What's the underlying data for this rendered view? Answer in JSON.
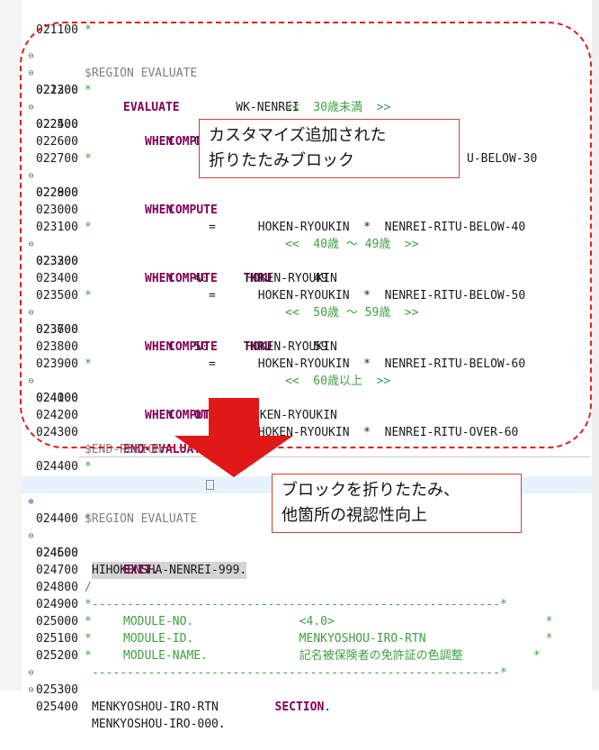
{
  "annotations": {
    "callout1": [
      "カスタマイズ追加された",
      "折りたたみブロック"
    ],
    "callout2": [
      "ブロックを折りたたみ、",
      "他箇所の視認性向上"
    ]
  },
  "top_lines": [
    {
      "seq": "021100",
      "mark": "*",
      "code": ""
    },
    {
      "seq": "",
      "mark": "",
      "code": "$REGION EVALUATE"
    },
    {
      "seq": "021200",
      "mark": "",
      "code": "EVALUATE        WK-NENREI"
    },
    {
      "seq": "022300",
      "mark": "*",
      "code": "<<  30歳未満  >>"
    },
    {
      "seq": "022400",
      "mark": "",
      "code": "WHEN   0      THRU      29"
    },
    {
      "seq": "022500",
      "mark": "",
      "code": "COMPUTE    HOKEN-RYOUKIN"
    },
    {
      "seq": "022600",
      "mark": "",
      "code": "U-BELOW-30"
    },
    {
      "seq": "022700",
      "mark": "*",
      "code": ""
    },
    {
      "seq": "022800",
      "mark": "",
      "code": "WHEN"
    },
    {
      "seq": "022900",
      "mark": "",
      "code": "COMPUTE"
    },
    {
      "seq": "023000",
      "mark": "",
      "code": "=      HOKEN-RYOUKIN  *  NENREI-RITU-BELOW-40"
    },
    {
      "seq": "023100",
      "mark": "*",
      "code": "<<  40歳 ～ 49歳  >>"
    },
    {
      "seq": "023200",
      "mark": "",
      "code": "WHEN   40     THRU      49"
    },
    {
      "seq": "023300",
      "mark": "",
      "code": "COMPUTE    HOKEN-RYOUKIN"
    },
    {
      "seq": "023400",
      "mark": "",
      "code": "=      HOKEN-RYOUKIN  *  NENREI-RITU-BELOW-50"
    },
    {
      "seq": "023500",
      "mark": "*",
      "code": "<<  50歳 ～ 59歳  >>"
    },
    {
      "seq": "023600",
      "mark": "",
      "code": "WHEN   50     THRU      59"
    },
    {
      "seq": "023700",
      "mark": "",
      "code": "COMPUTE    HOKEN-RYOUKIN"
    },
    {
      "seq": "023800",
      "mark": "",
      "code": "=      HOKEN-RYOUKIN  *  NENREI-RITU-BELOW-60"
    },
    {
      "seq": "023900",
      "mark": "*",
      "code": "<<  60歳以上  >>"
    },
    {
      "seq": "024000",
      "mark": "",
      "code": "WHEN   OTHER"
    },
    {
      "seq": "024100",
      "mark": "",
      "code": "COMPUTE    HOKEN-RYOUKIN"
    },
    {
      "seq": "024200",
      "mark": "",
      "code": "=      HOKEN-RYOUKIN  *  NENREI-RITU-OVER-60"
    },
    {
      "seq": "024300",
      "mark": "",
      "code": "END-EVALUATE"
    },
    {
      "seq": "",
      "mark": "",
      "code": "$END-REGION"
    },
    {
      "seq": "024400",
      "mark": "*",
      "code": ""
    }
  ],
  "bottom_lines": [
    {
      "seq": "021100",
      "mark": "*",
      "code": ""
    },
    {
      "seq": "",
      "mark": "",
      "code": "$REGION EVALUATE"
    },
    {
      "seq": "024400",
      "mark": "*",
      "code": ""
    },
    {
      "seq": "024500",
      "mark": "",
      "code": "HIHOKENSHA-NENREI-999."
    },
    {
      "seq": "024600",
      "mark": "",
      "code": "EXIT."
    },
    {
      "seq": "024700",
      "mark": "",
      "code": ""
    },
    {
      "seq": "024800",
      "mark": "/",
      "code": "----------------------------------------------------------*"
    },
    {
      "seq": "024900",
      "mark": "*",
      "code": "MODULE-NO.               <4.0>                              *"
    },
    {
      "seq": "025000",
      "mark": "*",
      "code": "MODULE-ID.               MENKYOSHOU-IRO-RTN                 *"
    },
    {
      "seq": "025100",
      "mark": "*",
      "code": "MODULE-NAME.             記名被保険者の免許証の色調整          *"
    },
    {
      "seq": "025200",
      "mark": "*",
      "code": "----------------------------------------------------------*"
    },
    {
      "seq": "025300",
      "mark": "",
      "code": "MENKYOSHOU-IRO-RTN        SECTION."
    },
    {
      "seq": "025400",
      "mark": "",
      "code": "MENKYOSHOU-IRO-000."
    }
  ]
}
